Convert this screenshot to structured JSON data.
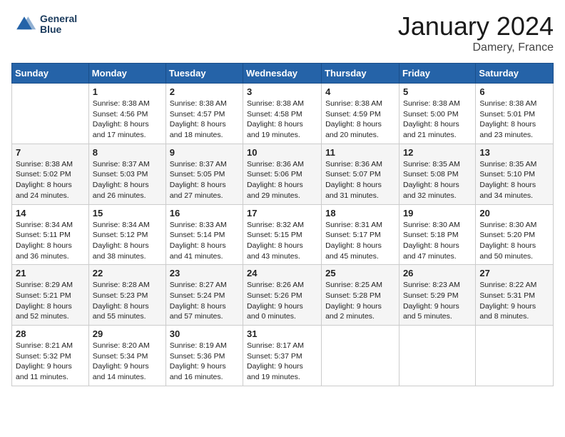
{
  "header": {
    "logo_line1": "General",
    "logo_line2": "Blue",
    "month_title": "January 2024",
    "location": "Damery, France"
  },
  "columns": [
    "Sunday",
    "Monday",
    "Tuesday",
    "Wednesday",
    "Thursday",
    "Friday",
    "Saturday"
  ],
  "weeks": [
    [
      {
        "day": "",
        "sunrise": "",
        "sunset": "",
        "daylight": ""
      },
      {
        "day": "1",
        "sunrise": "Sunrise: 8:38 AM",
        "sunset": "Sunset: 4:56 PM",
        "daylight": "Daylight: 8 hours and 17 minutes."
      },
      {
        "day": "2",
        "sunrise": "Sunrise: 8:38 AM",
        "sunset": "Sunset: 4:57 PM",
        "daylight": "Daylight: 8 hours and 18 minutes."
      },
      {
        "day": "3",
        "sunrise": "Sunrise: 8:38 AM",
        "sunset": "Sunset: 4:58 PM",
        "daylight": "Daylight: 8 hours and 19 minutes."
      },
      {
        "day": "4",
        "sunrise": "Sunrise: 8:38 AM",
        "sunset": "Sunset: 4:59 PM",
        "daylight": "Daylight: 8 hours and 20 minutes."
      },
      {
        "day": "5",
        "sunrise": "Sunrise: 8:38 AM",
        "sunset": "Sunset: 5:00 PM",
        "daylight": "Daylight: 8 hours and 21 minutes."
      },
      {
        "day": "6",
        "sunrise": "Sunrise: 8:38 AM",
        "sunset": "Sunset: 5:01 PM",
        "daylight": "Daylight: 8 hours and 23 minutes."
      }
    ],
    [
      {
        "day": "7",
        "sunrise": "Sunrise: 8:38 AM",
        "sunset": "Sunset: 5:02 PM",
        "daylight": "Daylight: 8 hours and 24 minutes."
      },
      {
        "day": "8",
        "sunrise": "Sunrise: 8:37 AM",
        "sunset": "Sunset: 5:03 PM",
        "daylight": "Daylight: 8 hours and 26 minutes."
      },
      {
        "day": "9",
        "sunrise": "Sunrise: 8:37 AM",
        "sunset": "Sunset: 5:05 PM",
        "daylight": "Daylight: 8 hours and 27 minutes."
      },
      {
        "day": "10",
        "sunrise": "Sunrise: 8:36 AM",
        "sunset": "Sunset: 5:06 PM",
        "daylight": "Daylight: 8 hours and 29 minutes."
      },
      {
        "day": "11",
        "sunrise": "Sunrise: 8:36 AM",
        "sunset": "Sunset: 5:07 PM",
        "daylight": "Daylight: 8 hours and 31 minutes."
      },
      {
        "day": "12",
        "sunrise": "Sunrise: 8:35 AM",
        "sunset": "Sunset: 5:08 PM",
        "daylight": "Daylight: 8 hours and 32 minutes."
      },
      {
        "day": "13",
        "sunrise": "Sunrise: 8:35 AM",
        "sunset": "Sunset: 5:10 PM",
        "daylight": "Daylight: 8 hours and 34 minutes."
      }
    ],
    [
      {
        "day": "14",
        "sunrise": "Sunrise: 8:34 AM",
        "sunset": "Sunset: 5:11 PM",
        "daylight": "Daylight: 8 hours and 36 minutes."
      },
      {
        "day": "15",
        "sunrise": "Sunrise: 8:34 AM",
        "sunset": "Sunset: 5:12 PM",
        "daylight": "Daylight: 8 hours and 38 minutes."
      },
      {
        "day": "16",
        "sunrise": "Sunrise: 8:33 AM",
        "sunset": "Sunset: 5:14 PM",
        "daylight": "Daylight: 8 hours and 41 minutes."
      },
      {
        "day": "17",
        "sunrise": "Sunrise: 8:32 AM",
        "sunset": "Sunset: 5:15 PM",
        "daylight": "Daylight: 8 hours and 43 minutes."
      },
      {
        "day": "18",
        "sunrise": "Sunrise: 8:31 AM",
        "sunset": "Sunset: 5:17 PM",
        "daylight": "Daylight: 8 hours and 45 minutes."
      },
      {
        "day": "19",
        "sunrise": "Sunrise: 8:30 AM",
        "sunset": "Sunset: 5:18 PM",
        "daylight": "Daylight: 8 hours and 47 minutes."
      },
      {
        "day": "20",
        "sunrise": "Sunrise: 8:30 AM",
        "sunset": "Sunset: 5:20 PM",
        "daylight": "Daylight: 8 hours and 50 minutes."
      }
    ],
    [
      {
        "day": "21",
        "sunrise": "Sunrise: 8:29 AM",
        "sunset": "Sunset: 5:21 PM",
        "daylight": "Daylight: 8 hours and 52 minutes."
      },
      {
        "day": "22",
        "sunrise": "Sunrise: 8:28 AM",
        "sunset": "Sunset: 5:23 PM",
        "daylight": "Daylight: 8 hours and 55 minutes."
      },
      {
        "day": "23",
        "sunrise": "Sunrise: 8:27 AM",
        "sunset": "Sunset: 5:24 PM",
        "daylight": "Daylight: 8 hours and 57 minutes."
      },
      {
        "day": "24",
        "sunrise": "Sunrise: 8:26 AM",
        "sunset": "Sunset: 5:26 PM",
        "daylight": "Daylight: 9 hours and 0 minutes."
      },
      {
        "day": "25",
        "sunrise": "Sunrise: 8:25 AM",
        "sunset": "Sunset: 5:28 PM",
        "daylight": "Daylight: 9 hours and 2 minutes."
      },
      {
        "day": "26",
        "sunrise": "Sunrise: 8:23 AM",
        "sunset": "Sunset: 5:29 PM",
        "daylight": "Daylight: 9 hours and 5 minutes."
      },
      {
        "day": "27",
        "sunrise": "Sunrise: 8:22 AM",
        "sunset": "Sunset: 5:31 PM",
        "daylight": "Daylight: 9 hours and 8 minutes."
      }
    ],
    [
      {
        "day": "28",
        "sunrise": "Sunrise: 8:21 AM",
        "sunset": "Sunset: 5:32 PM",
        "daylight": "Daylight: 9 hours and 11 minutes."
      },
      {
        "day": "29",
        "sunrise": "Sunrise: 8:20 AM",
        "sunset": "Sunset: 5:34 PM",
        "daylight": "Daylight: 9 hours and 14 minutes."
      },
      {
        "day": "30",
        "sunrise": "Sunrise: 8:19 AM",
        "sunset": "Sunset: 5:36 PM",
        "daylight": "Daylight: 9 hours and 16 minutes."
      },
      {
        "day": "31",
        "sunrise": "Sunrise: 8:17 AM",
        "sunset": "Sunset: 5:37 PM",
        "daylight": "Daylight: 9 hours and 19 minutes."
      },
      {
        "day": "",
        "sunrise": "",
        "sunset": "",
        "daylight": ""
      },
      {
        "day": "",
        "sunrise": "",
        "sunset": "",
        "daylight": ""
      },
      {
        "day": "",
        "sunrise": "",
        "sunset": "",
        "daylight": ""
      }
    ]
  ]
}
